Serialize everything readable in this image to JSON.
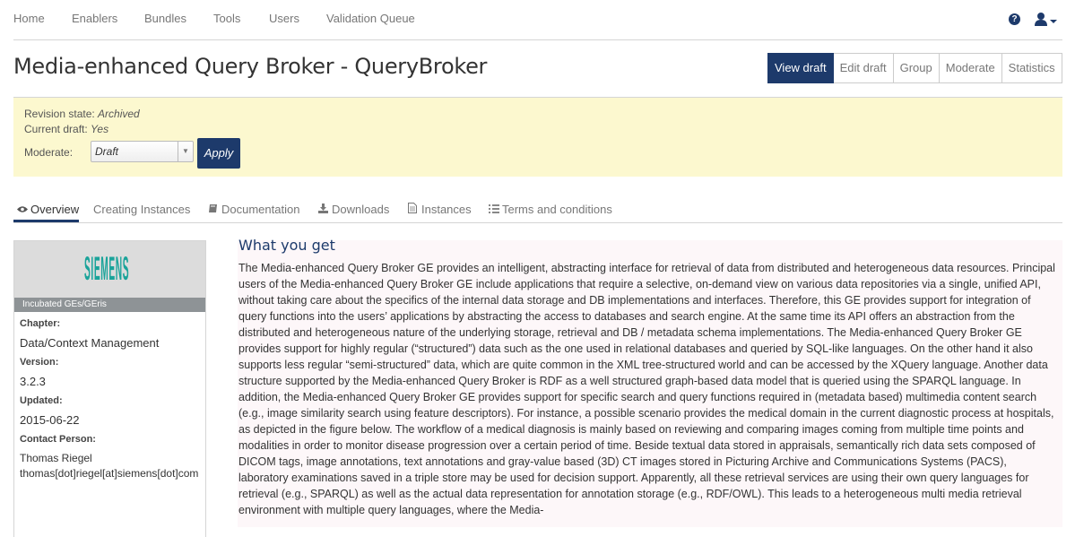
{
  "nav": {
    "items": [
      "Home",
      "Enablers",
      "Bundles",
      "Tools",
      "Users",
      "Validation Queue"
    ],
    "help_icon": "?"
  },
  "title": "Media-enhanced Query Broker - QueryBroker",
  "actions": [
    "View draft",
    "Edit draft",
    "Group",
    "Moderate",
    "Statistics"
  ],
  "notice": {
    "revision_label": "Revision state:",
    "revision_value": "Archived",
    "draft_label": "Current draft:",
    "draft_value": "Yes",
    "moderate_label": "Moderate:",
    "moderate_value": "Draft",
    "apply_label": "Apply"
  },
  "tabs": [
    {
      "label": "Overview",
      "icon": "eye-icon"
    },
    {
      "label": "Creating Instances",
      "icon": ""
    },
    {
      "label": "Documentation",
      "icon": "book-icon"
    },
    {
      "label": "Downloads",
      "icon": "download-icon"
    },
    {
      "label": "Instances",
      "icon": "file-icon"
    },
    {
      "label": "Terms and conditions",
      "icon": "list-icon"
    }
  ],
  "sidebar": {
    "logo_text": "SIEMENS",
    "caption": "Incubated GEs/GEris",
    "chapter_label": "Chapter:",
    "chapter_value": "Data/Context Management",
    "version_label": "Version:",
    "version_value": "3.2.3",
    "updated_label": "Updated:",
    "updated_value": "2015-06-22",
    "contact_label": "Contact Person:",
    "contact_name": "Thomas Riegel",
    "contact_email": "thomas[dot]riegel[at]siemens[dot]com"
  },
  "main": {
    "heading": "What you get",
    "body": "The Media-enhanced Query Broker GE provides an intelligent, abstracting interface for retrieval of data from distributed and heterogeneous data resources. Principal users of the Media-enhanced Query Broker GE include applications that require a selective, on-demand view on various data repositories via a single, unified API, without taking care about the specifics of the internal data storage and DB implementations and interfaces. Therefore, this GE provides support for integration of query functions into the users’ applications by abstracting the access to databases and search engine. At the same time its API offers an abstraction from the distributed and heterogeneous nature of the underlying storage, retrieval and DB / metadata schema implementations. The Media-enhanced Query Broker GE provides support for highly regular (“structured”) data such as the one used in relational databases and queried by SQL-like languages. On the other hand it also supports less regular “semi-structured” data, which are quite common in the XML tree-structured world and can be accessed by the XQuery language. Another data structure supported by the Media-enhanced Query Broker is RDF as a well structured graph-based data model that is queried using the SPARQL language. In addition, the Media-enhanced Query Broker GE provides support for specific search and query functions required in (metadata based) multimedia content search (e.g., image similarity search using feature descriptors). For instance, a possible scenario provides the medical domain in the current diagnostic process at hospitals, as depicted in the figure below. The workflow of a medical diagnosis is mainly based on reviewing and comparing images coming from multiple time points and modalities in order to monitor disease progression over a certain period of time. Beside textual data stored in appraisals, semantically rich data sets composed of DICOM tags, image annotations, text annotations and gray-value based (3D) CT images stored in Picturing Archive and Communications Systems (PACS), laboratory examinations saved in a triple store may be used for decision support. Apparently, all these retrieval services are using their own query languages for retrieval (e.g., SPARQL) as well as the actual data representation for annotation storage (e.g., RDF/OWL). This leads to a heterogeneous multi media retrieval environment with multiple query languages, where the Media-"
  },
  "colors": {
    "accent": "#1d3a6b",
    "notice_bg": "#fcf8cf",
    "siemens_teal": "#1aa39a"
  }
}
